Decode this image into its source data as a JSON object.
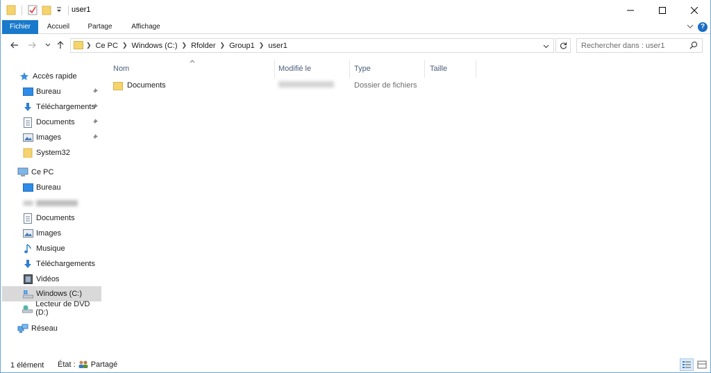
{
  "window": {
    "title": "user1",
    "accent": "#1979ca"
  },
  "ribbon": {
    "tabs": [
      "Fichier",
      "Accueil",
      "Partage",
      "Affichage"
    ],
    "help": "?"
  },
  "address": {
    "crumbs": [
      "Ce PC",
      "Windows (C:)",
      "Rfolder",
      "Group1",
      "user1"
    ]
  },
  "search": {
    "placeholder": "Rechercher dans : user1"
  },
  "nav": {
    "quick_access": "Accès rapide",
    "quick_items": [
      {
        "label": "Bureau",
        "icon": "desktop-icon",
        "pinned": true
      },
      {
        "label": "Téléchargements",
        "icon": "download-icon",
        "pinned": true
      },
      {
        "label": "Documents",
        "icon": "document-icon",
        "pinned": true
      },
      {
        "label": "Images",
        "icon": "image-icon",
        "pinned": true
      },
      {
        "label": "System32",
        "icon": "folder-icon",
        "pinned": false
      }
    ],
    "this_pc": "Ce PC",
    "pc_items": [
      {
        "label": "Bureau",
        "icon": "desktop-icon"
      },
      {
        "label": "Documents",
        "icon": "document-icon"
      },
      {
        "label": "Images",
        "icon": "image-icon"
      },
      {
        "label": "Musique",
        "icon": "music-icon"
      },
      {
        "label": "Téléchargements",
        "icon": "download-icon"
      },
      {
        "label": "Vidéos",
        "icon": "video-icon"
      },
      {
        "label": "Windows (C:)",
        "icon": "drive-icon",
        "selected": true
      },
      {
        "label": "Lecteur de DVD (D:)",
        "icon": "dvd-drive-icon"
      }
    ],
    "network": "Réseau"
  },
  "columns": [
    "Nom",
    "Modifié le",
    "Type",
    "Taille"
  ],
  "files": [
    {
      "name": "Documents",
      "type": "Dossier de fichiers",
      "size": ""
    }
  ],
  "status": {
    "count": "1 élément",
    "state_label": "État :",
    "state_value": "Partagé"
  }
}
